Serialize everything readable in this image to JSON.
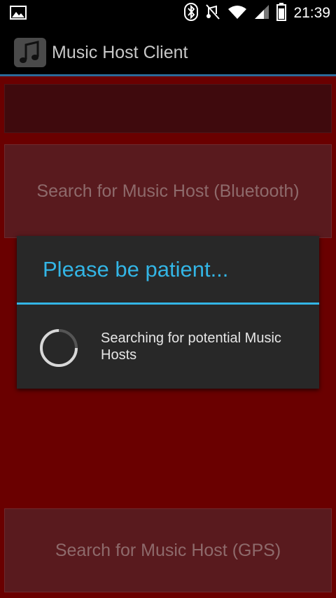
{
  "status_bar": {
    "time": "21:39",
    "icons": [
      "picture-notification-icon",
      "bluetooth-icon",
      "muted-icon",
      "wifi-icon",
      "signal-icon",
      "battery-icon"
    ]
  },
  "action_bar": {
    "title": "Music Host Client",
    "icon": "music-note-icon"
  },
  "main": {
    "bluetooth_button": "Search for Music Host (Bluetooth)",
    "gps_button": "Search for Music Host (GPS)"
  },
  "dialog": {
    "title": "Please be patient...",
    "message": "Searching for potential Music Hosts"
  },
  "colors": {
    "accent": "#33b5e5",
    "background": "#6a0000",
    "button": "#591a1e"
  }
}
